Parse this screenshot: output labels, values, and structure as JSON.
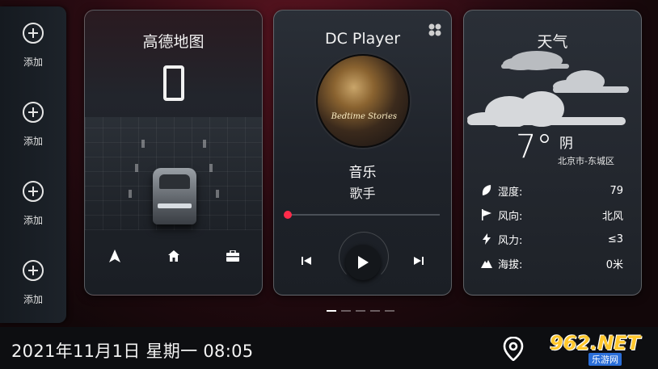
{
  "sidebar": {
    "items": [
      {
        "label": "添加"
      },
      {
        "label": "添加"
      },
      {
        "label": "添加"
      },
      {
        "label": "添加"
      }
    ]
  },
  "map_card": {
    "title": "高德地图",
    "speed": "0",
    "buttons": [
      "navigate-arrow-icon",
      "home-icon",
      "briefcase-icon"
    ]
  },
  "music_card": {
    "title": "DC Player",
    "song": "音乐",
    "artist": "歌手",
    "album_text": "Bedtime Stories",
    "progress": 0.0
  },
  "weather_card": {
    "title": "天气",
    "temperature": "7°",
    "condition": "阴",
    "location": "北京市-东城区",
    "rows": [
      {
        "icon": "leaf-icon",
        "label": "湿度:",
        "value": "79"
      },
      {
        "icon": "flag-icon",
        "label": "风向:",
        "value": "北风"
      },
      {
        "icon": "lightning-icon",
        "label": "风力:",
        "value": "≤3"
      },
      {
        "icon": "mountain-icon",
        "label": "海拔:",
        "value": "0米"
      }
    ]
  },
  "pager": {
    "count": 5,
    "active": 0
  },
  "bottom_bar": {
    "datetime": "2021年11月1日 星期一 08:05"
  },
  "watermark": {
    "main": "962.NET",
    "sub": "乐游网"
  },
  "colors": {
    "accent": "#ff2b4a",
    "background": "#2a0b12",
    "card": "#23272e"
  }
}
